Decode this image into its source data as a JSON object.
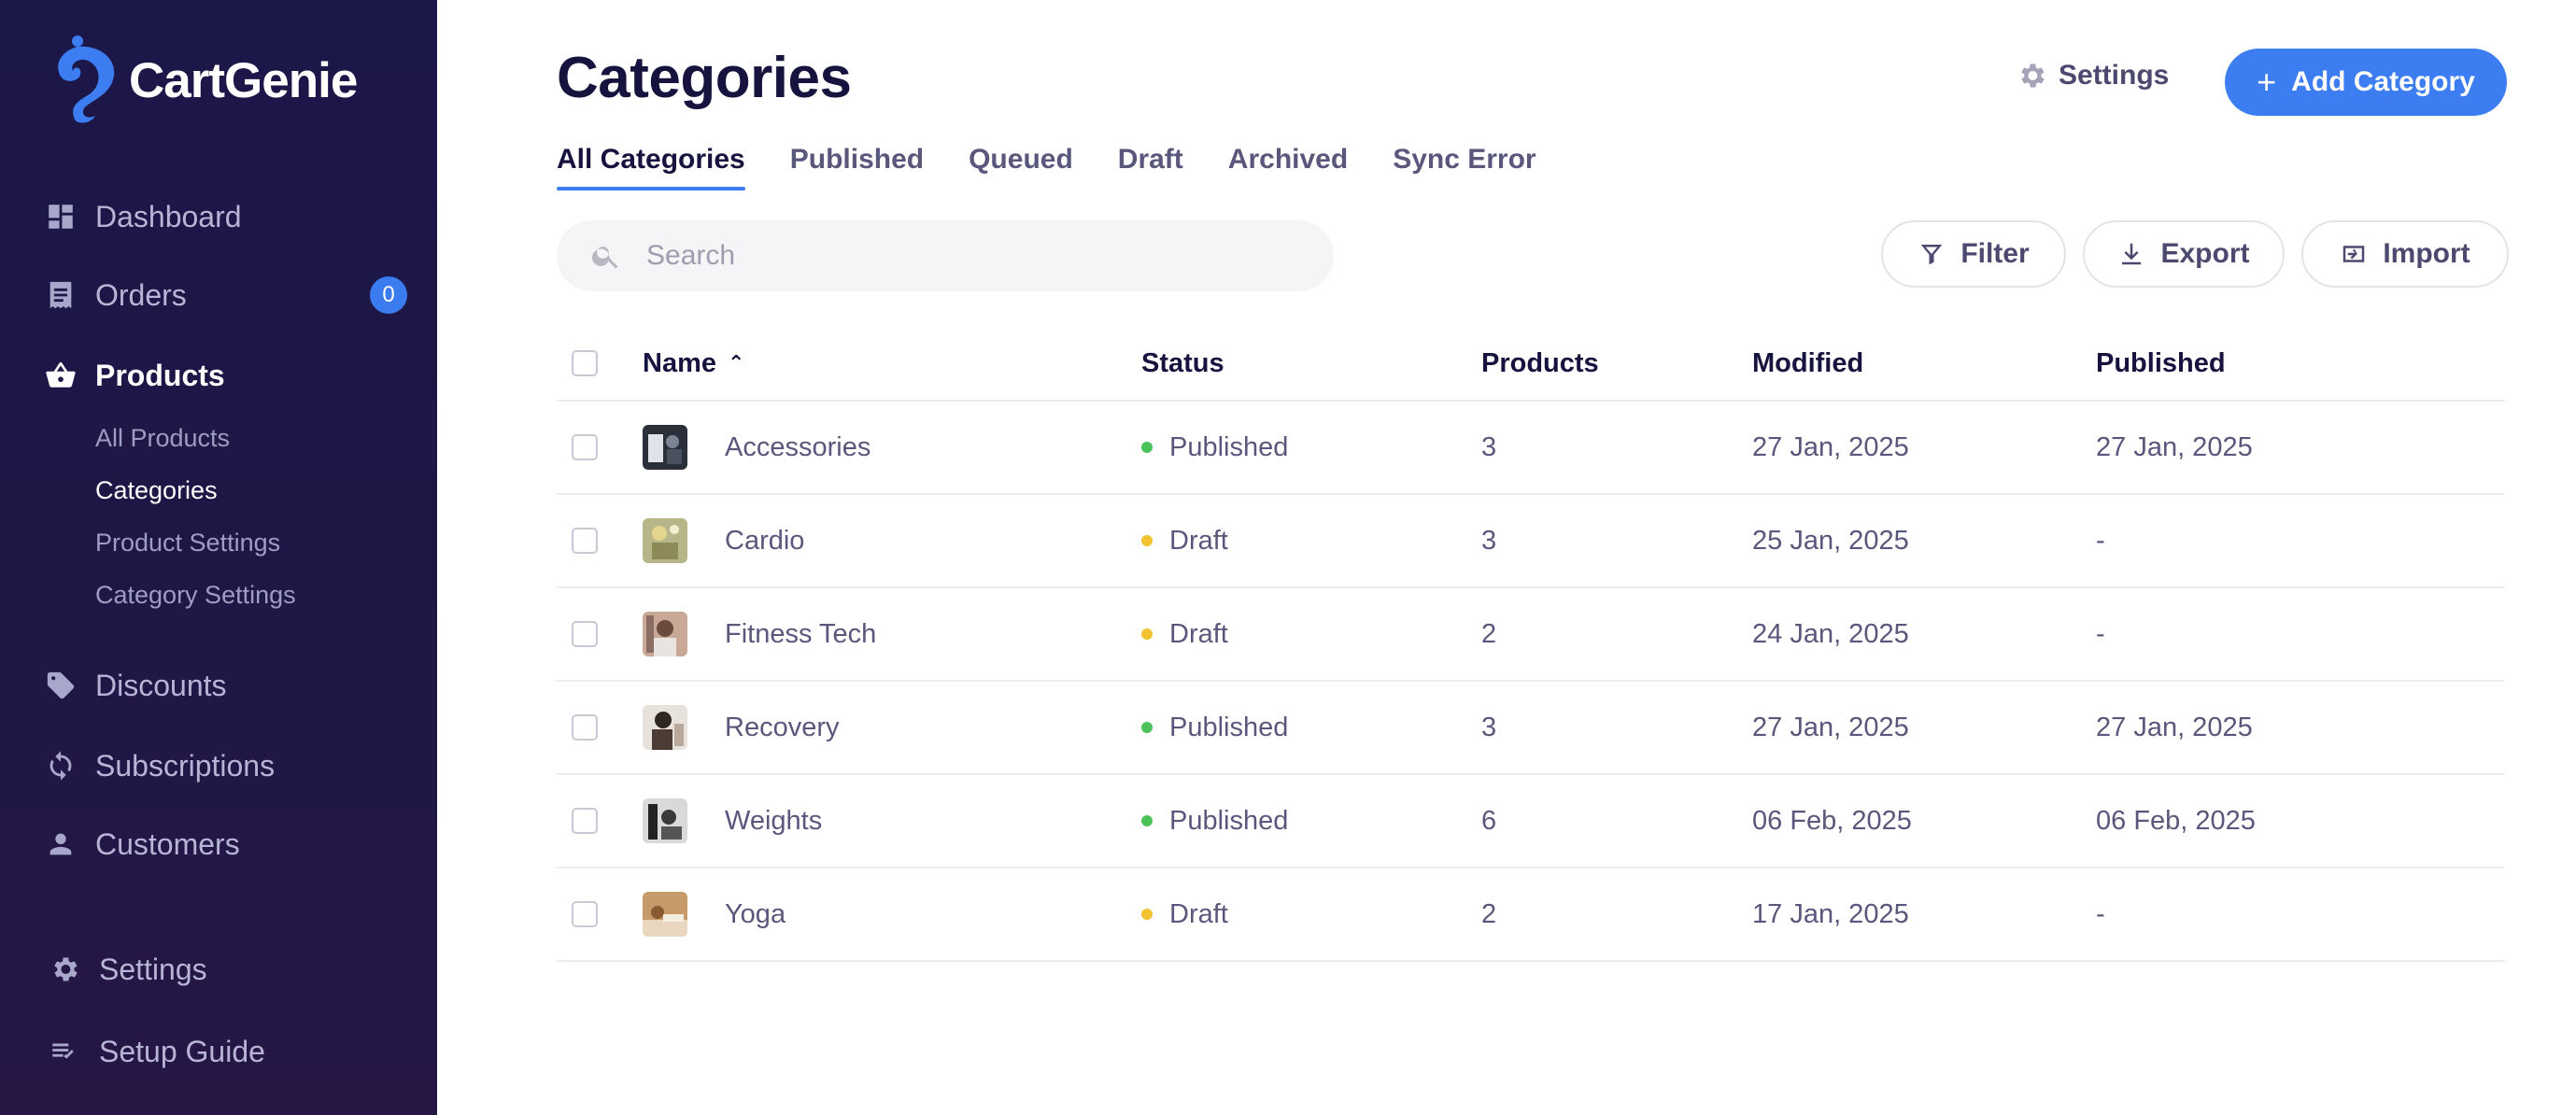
{
  "brand": {
    "name": "CartGenie",
    "accent": "#3c7df2"
  },
  "sidebar": {
    "items": [
      {
        "label": "Dashboard",
        "icon": "dashboard-icon"
      },
      {
        "label": "Orders",
        "icon": "receipt-icon",
        "badge": "0"
      },
      {
        "label": "Products",
        "icon": "basket-icon",
        "active": true
      },
      {
        "label": "Discounts",
        "icon": "tag-icon"
      },
      {
        "label": "Subscriptions",
        "icon": "sync-icon"
      },
      {
        "label": "Customers",
        "icon": "person-icon"
      }
    ],
    "subitems": [
      {
        "label": "All Products"
      },
      {
        "label": "Categories",
        "active": true
      },
      {
        "label": "Product Settings"
      },
      {
        "label": "Category Settings"
      }
    ],
    "footer": [
      {
        "label": "Settings",
        "icon": "gear-icon"
      },
      {
        "label": "Setup Guide",
        "icon": "checklist-icon"
      }
    ]
  },
  "header": {
    "title": "Categories",
    "settings_label": "Settings",
    "add_label": "Add Category"
  },
  "tabs": [
    {
      "label": "All Categories",
      "active": true
    },
    {
      "label": "Published"
    },
    {
      "label": "Queued"
    },
    {
      "label": "Draft"
    },
    {
      "label": "Archived"
    },
    {
      "label": "Sync Error"
    }
  ],
  "toolbar": {
    "search_placeholder": "Search",
    "filter_label": "Filter",
    "export_label": "Export",
    "import_label": "Import"
  },
  "table": {
    "columns": {
      "name": "Name",
      "status": "Status",
      "products": "Products",
      "modified": "Modified",
      "published": "Published"
    },
    "status_colors": {
      "Published": "#4cc35a",
      "Draft": "#f2c230"
    },
    "rows": [
      {
        "name": "Accessories",
        "status": "Published",
        "products": "3",
        "modified": "27 Jan, 2025",
        "published": "27 Jan, 2025"
      },
      {
        "name": "Cardio",
        "status": "Draft",
        "products": "3",
        "modified": "25 Jan, 2025",
        "published": "-"
      },
      {
        "name": "Fitness Tech",
        "status": "Draft",
        "products": "2",
        "modified": "24 Jan, 2025",
        "published": "-"
      },
      {
        "name": "Recovery",
        "status": "Published",
        "products": "3",
        "modified": "27 Jan, 2025",
        "published": "27 Jan, 2025"
      },
      {
        "name": "Weights",
        "status": "Published",
        "products": "6",
        "modified": "06 Feb, 2025",
        "published": "06 Feb, 2025"
      },
      {
        "name": "Yoga",
        "status": "Draft",
        "products": "2",
        "modified": "17 Jan, 2025",
        "published": "-"
      }
    ]
  }
}
